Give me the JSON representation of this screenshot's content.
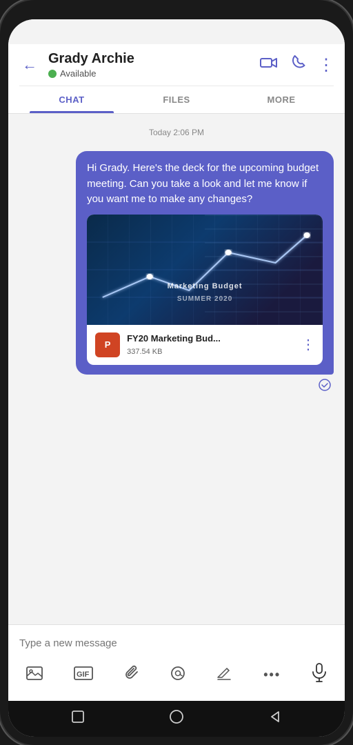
{
  "phone": {
    "status_bar": ""
  },
  "header": {
    "back_label": "←",
    "contact_name": "Grady Archie",
    "status_text": "Available",
    "video_icon": "📹",
    "phone_icon": "📞",
    "more_icon": "⋮"
  },
  "tabs": [
    {
      "label": "CHAT",
      "active": true
    },
    {
      "label": "FILES",
      "active": false
    },
    {
      "label": "MORE",
      "active": false
    }
  ],
  "chat": {
    "timestamp": "Today 2:06 PM",
    "message_text": "Hi Grady. Here's the deck for the upcoming budget meeting. Can you take a look and let me know if you want me to make any changes?",
    "attachment": {
      "preview_label": "Marketing Budget",
      "preview_sublabel": "SUMMER 2020",
      "file_name": "FY20 Marketing Bud...",
      "file_size": "337.54 KB",
      "file_icon": "P"
    }
  },
  "compose": {
    "placeholder": "Type a new message"
  },
  "toolbar": {
    "icons": [
      "🖼",
      "GIF",
      "📎",
      "@",
      "✍",
      "•••",
      "🎤"
    ]
  }
}
